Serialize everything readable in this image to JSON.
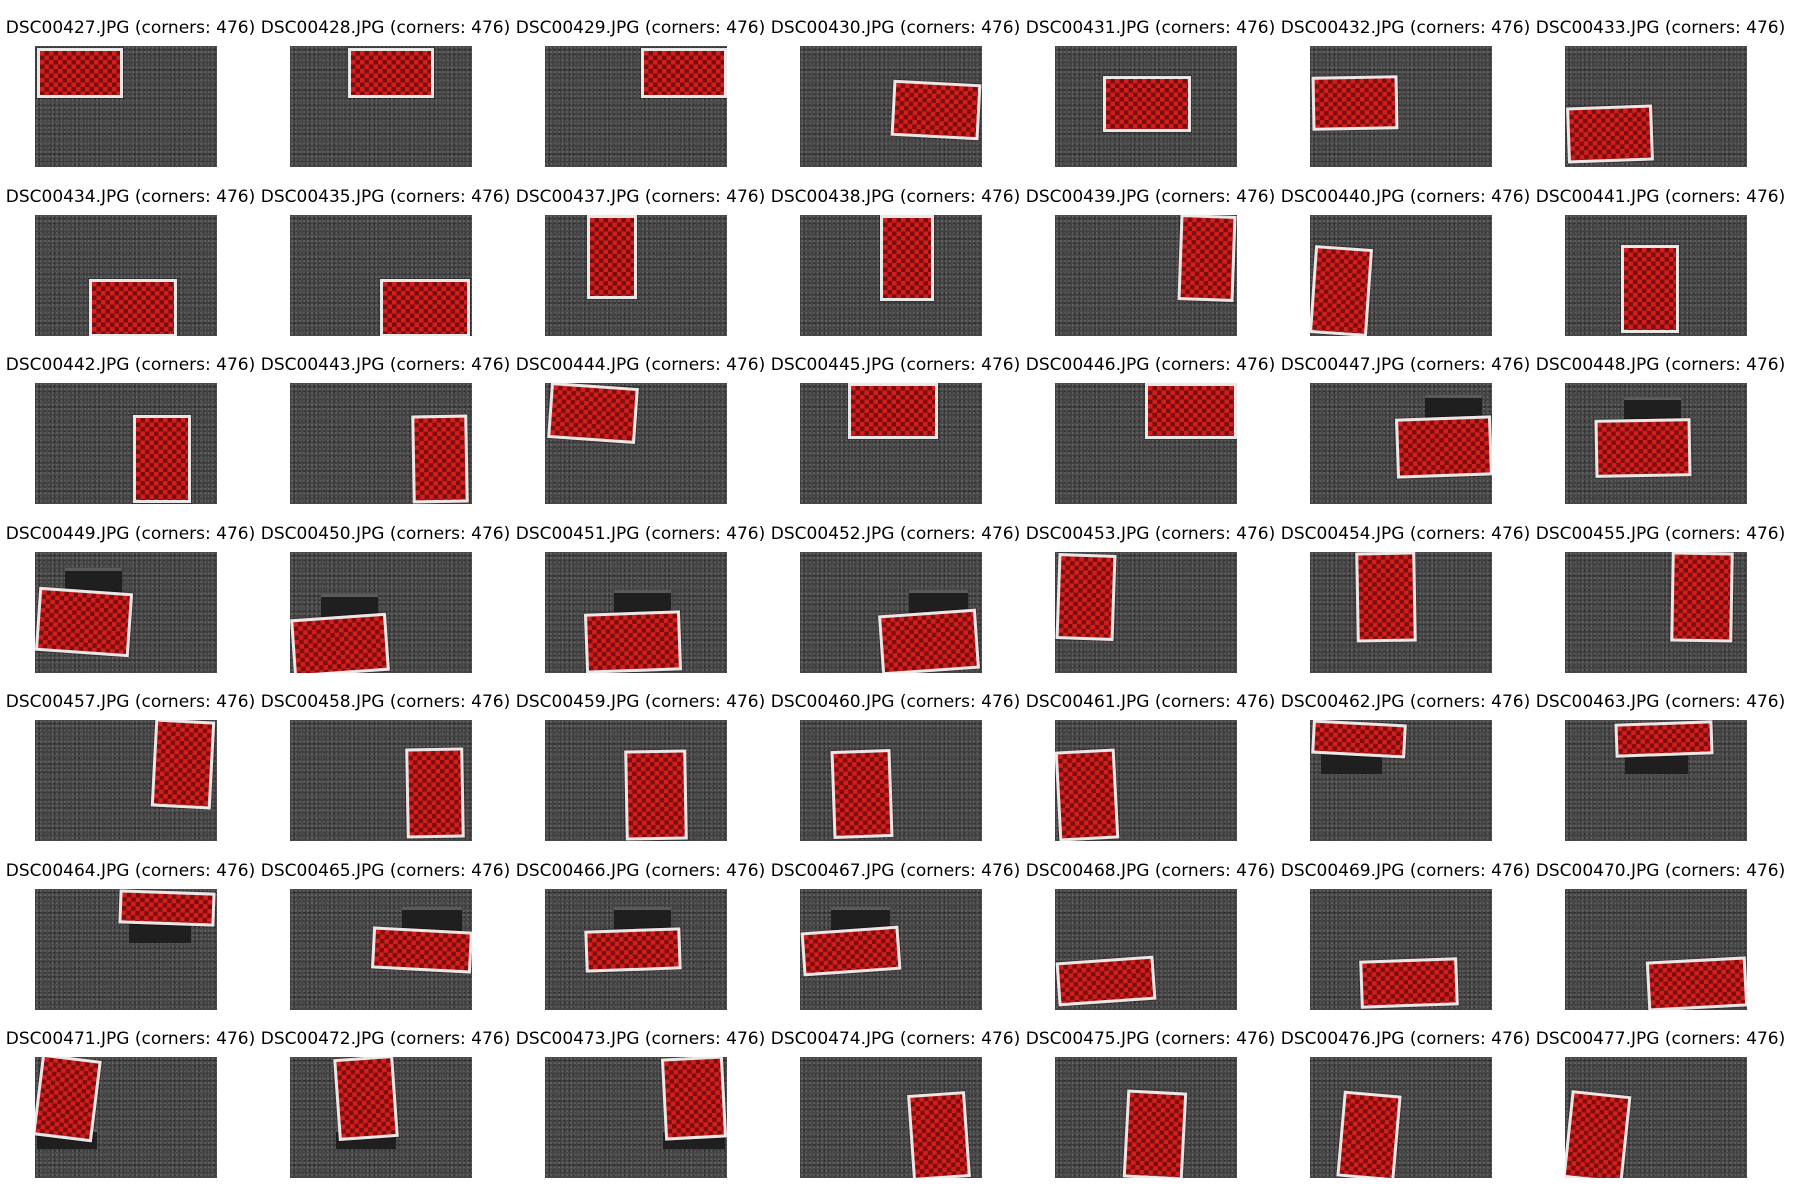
{
  "figure": {
    "background": "#ffffff",
    "images": [
      {
        "title": "DSC00427.JPG (corners: 476)"
      },
      {
        "title": "DSC00428.JPG (corners: 476)"
      },
      {
        "title": "DSC00429.JPG (corners: 476)"
      },
      {
        "title": "DSC00430.JPG (corners: 476)"
      },
      {
        "title": "DSC00431.JPG (corners: 476)"
      },
      {
        "title": "DSC00432.JPG (corners: 476)"
      },
      {
        "title": "DSC00433.JPG (corners: 476)"
      },
      {
        "title": "DSC00434.JPG (corners: 476)"
      },
      {
        "title": "DSC00435.JPG (corners: 476)"
      },
      {
        "title": "DSC00437.JPG (corners: 476)"
      },
      {
        "title": "DSC00438.JPG (corners: 476)"
      },
      {
        "title": "DSC00439.JPG (corners: 476)"
      },
      {
        "title": "DSC00440.JPG (corners: 476)"
      },
      {
        "title": "DSC00441.JPG (corners: 476)"
      },
      {
        "title": "DSC00442.JPG (corners: 476)"
      },
      {
        "title": "DSC00443.JPG (corners: 476)"
      },
      {
        "title": "DSC00444.JPG (corners: 476)"
      },
      {
        "title": "DSC00445.JPG (corners: 476)"
      },
      {
        "title": "DSC00446.JPG (corners: 476)"
      },
      {
        "title": "DSC00447.JPG (corners: 476)"
      },
      {
        "title": "DSC00448.JPG (corners: 476)"
      },
      {
        "title": "DSC00449.JPG (corners: 476)"
      },
      {
        "title": "DSC00450.JPG (corners: 476)"
      },
      {
        "title": "DSC00451.JPG (corners: 476)"
      },
      {
        "title": "DSC00452.JPG (corners: 476)"
      },
      {
        "title": "DSC00453.JPG (corners: 476)"
      },
      {
        "title": "DSC00454.JPG (corners: 476)"
      },
      {
        "title": "DSC00455.JPG (corners: 476)"
      },
      {
        "title": "DSC00457.JPG (corners: 476)"
      },
      {
        "title": "DSC00458.JPG (corners: 476)"
      },
      {
        "title": "DSC00459.JPG (corners: 476)"
      },
      {
        "title": "DSC00460.JPG (corners: 476)"
      },
      {
        "title": "DSC00461.JPG (corners: 476)"
      },
      {
        "title": "DSC00462.JPG (corners: 476)"
      },
      {
        "title": "DSC00463.JPG (corners: 476)"
      },
      {
        "title": "DSC00464.JPG (corners: 476)"
      },
      {
        "title": "DSC00465.JPG (corners: 476)"
      },
      {
        "title": "DSC00466.JPG (corners: 476)"
      },
      {
        "title": "DSC00467.JPG (corners: 476)"
      },
      {
        "title": "DSC00468.JPG (corners: 476)"
      },
      {
        "title": "DSC00469.JPG (corners: 476)"
      },
      {
        "title": "DSC00470.JPG (corners: 476)"
      },
      {
        "title": "DSC00471.JPG (corners: 476)"
      },
      {
        "title": "DSC00472.JPG (corners: 476)"
      },
      {
        "title": "DSC00473.JPG (corners: 476)"
      },
      {
        "title": "DSC00474.JPG (corners: 476)"
      },
      {
        "title": "DSC00475.JPG (corners: 476)"
      },
      {
        "title": "DSC00476.JPG (corners: 476)"
      },
      {
        "title": "DSC00477.JPG (corners: 476)"
      }
    ]
  }
}
